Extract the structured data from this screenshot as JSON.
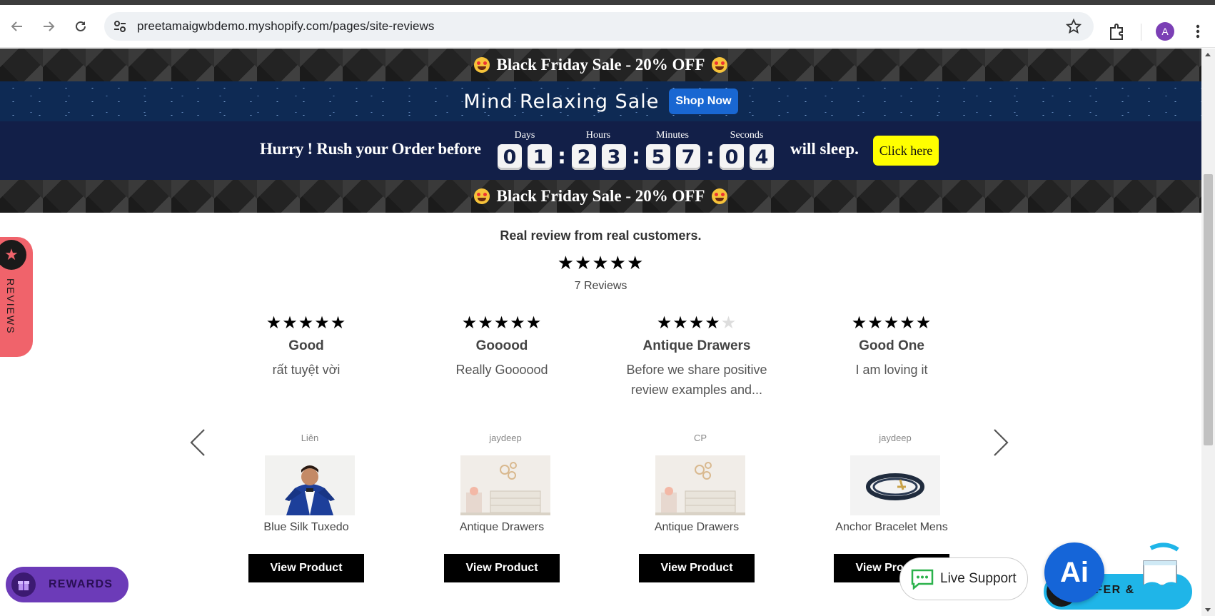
{
  "browser": {
    "url": "preetamaigwbdemo.myshopify.com/pages/site-reviews",
    "profile_initial": "A"
  },
  "banners": {
    "black_friday_text": "Black Friday Sale - 20% OFF",
    "relax_text": "Mind Relaxing Sale",
    "shop_now_label": "Shop Now",
    "hurry_text": "Hurry ! Rush your Order before",
    "sleep_text": "will sleep.",
    "click_here_label": "Click here",
    "countdown": {
      "days_label": "Days",
      "hours_label": "Hours",
      "minutes_label": "Minutes",
      "seconds_label": "Seconds",
      "days": [
        "0",
        "1"
      ],
      "hours": [
        "2",
        "3"
      ],
      "minutes": [
        "5",
        "7"
      ],
      "seconds": [
        "0",
        "4"
      ]
    }
  },
  "reviews": {
    "heading": "Real review from real customers.",
    "summary_rating": 5,
    "summary_stars": "★★★★★",
    "count_label": "7 Reviews",
    "cards": [
      {
        "stars_filled": "★★★★★",
        "stars_empty": "",
        "rating": 5,
        "title": "Good",
        "body": "rất tuyệt vời",
        "author": "Liên",
        "product": "Blue Silk Tuxedo",
        "button": "View Product"
      },
      {
        "stars_filled": "★★★★★",
        "stars_empty": "",
        "rating": 5,
        "title": "Gooood",
        "body": "Really Goooood",
        "author": "jaydeep",
        "product": "Antique Drawers",
        "button": "View Product"
      },
      {
        "stars_filled": "★★★★",
        "stars_empty": "★",
        "rating": 4,
        "title": "Antique Drawers",
        "body": "Before we share positive review examples and...",
        "author": "CP",
        "product": "Antique Drawers",
        "button": "View Product"
      },
      {
        "stars_filled": "★★★★★",
        "stars_empty": "",
        "rating": 5,
        "title": "Good One",
        "body": "I am loving it",
        "author": "jaydeep",
        "product": "Anchor Bracelet Mens",
        "button": "View Product"
      }
    ]
  },
  "widgets": {
    "reviews_tab_label": "REVIEWS",
    "rewards_label": "REWARDS",
    "live_support_label": "Live Support",
    "ai_label": "Ai",
    "refer_label": "EFER &"
  },
  "colors": {
    "reviews_tab": "#f0636b",
    "rewards": "#6c3bb8",
    "ai_button": "#1565d8",
    "refer": "#1fb5e8",
    "click_here": "#ffff00",
    "shop_now": "#1967d2"
  }
}
